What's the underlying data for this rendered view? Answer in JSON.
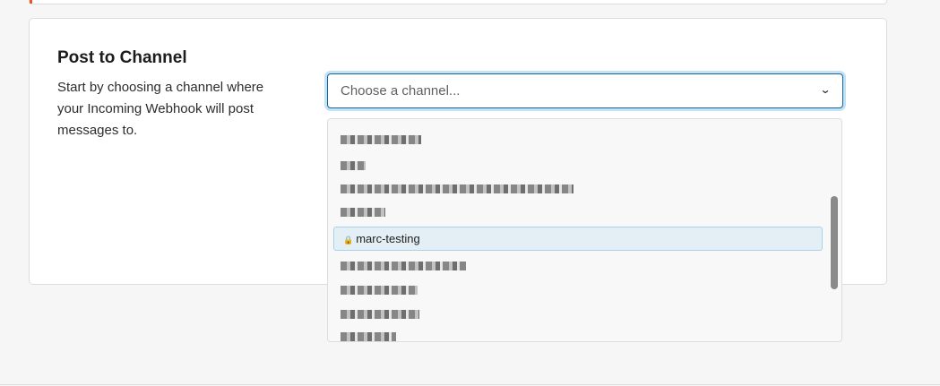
{
  "section": {
    "title": "Post to Channel",
    "description": "Start by choosing a channel where your Incoming Webhook will post messages to."
  },
  "select": {
    "placeholder": "Choose a channel...",
    "chevron": "chevron-down-icon"
  },
  "dropdown": {
    "highlighted_item": "marc-testing",
    "highlighted_icon": "lock-icon",
    "other_items": "redacted"
  },
  "colors": {
    "accent": "#e8562a",
    "focus": "#1264a3",
    "highlight": "#e3eff5"
  }
}
